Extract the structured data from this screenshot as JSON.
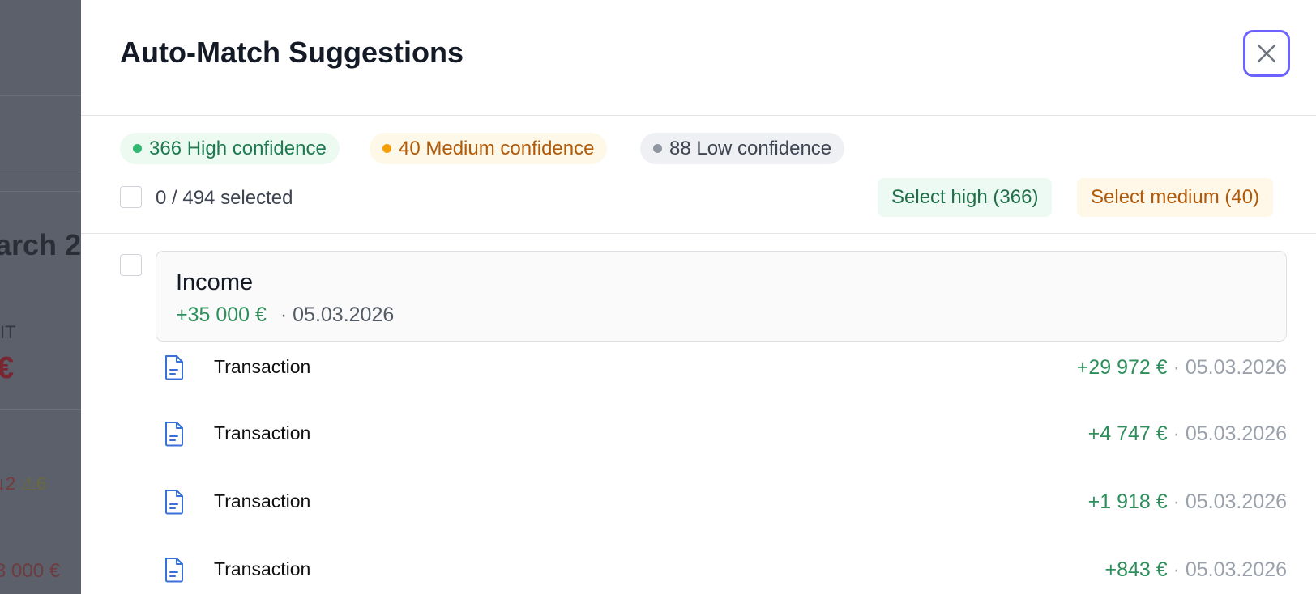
{
  "backdrop": {
    "heading_fragment": "arch 2",
    "label_fragment": "IT",
    "euro_fragment": "€",
    "stats_down": "↓2",
    "stats_warn": "⚠6",
    "amount_fragment": "3 000 €"
  },
  "modal": {
    "title": "Auto-Match Suggestions",
    "close_icon": "close-icon",
    "accent_color": "#6c63ff"
  },
  "confidence": {
    "high": {
      "label": "366 High confidence",
      "color": "#2fb86f"
    },
    "medium": {
      "label": "40 Medium confidence",
      "color": "#f59e0b"
    },
    "low": {
      "label": "88 Low confidence",
      "color": "#9097a3"
    }
  },
  "selection": {
    "text": "0 / 494 selected",
    "select_high_label": "Select high (366)",
    "select_medium_label": "Select medium (40)"
  },
  "group": {
    "title": "Income",
    "amount": "+35 000 €",
    "date": "· 05.03.2026"
  },
  "transactions": [
    {
      "label": "Transaction",
      "amount": "+29 972 €",
      "date": " · 05.03.2026",
      "icon": "document-icon"
    },
    {
      "label": "Transaction",
      "amount": "+4 747 €",
      "date": " · 05.03.2026",
      "icon": "document-icon"
    },
    {
      "label": "Transaction",
      "amount": "+1 918 €",
      "date": " · 05.03.2026",
      "icon": "document-icon"
    },
    {
      "label": "Transaction",
      "amount": "+843 €",
      "date": " · 05.03.2026",
      "icon": "document-icon"
    }
  ]
}
